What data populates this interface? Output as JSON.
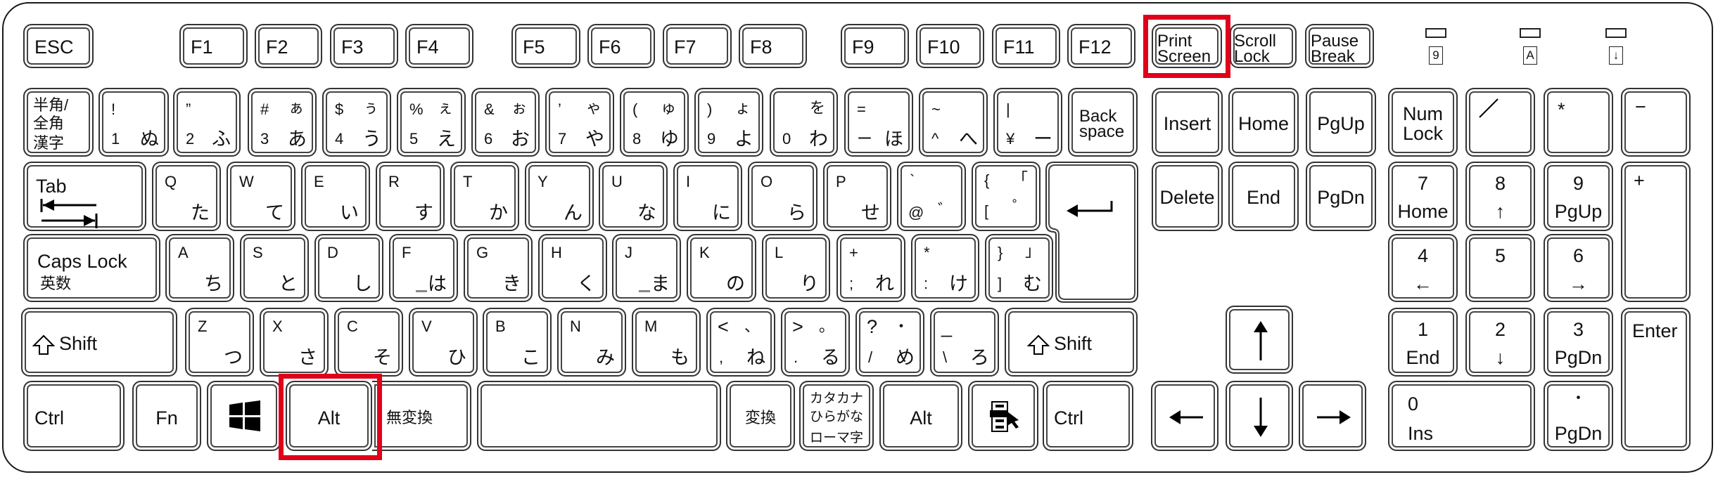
{
  "keyboard": {
    "layout": "JIS",
    "highlight_color": "#e0001b",
    "highlighted_keys": [
      "Print Screen",
      "Alt"
    ],
    "function_row": {
      "esc": "ESC",
      "f_keys": [
        "F1",
        "F2",
        "F3",
        "F4",
        "F5",
        "F6",
        "F7",
        "F8",
        "F9",
        "F10",
        "F11",
        "F12"
      ],
      "print_screen": [
        "Print",
        "Screen"
      ],
      "scroll_lock": [
        "Scroll",
        "Lock"
      ],
      "pause_break": [
        "Pause",
        "Break"
      ]
    },
    "indicators": [
      {
        "name": "num-lock-indicator",
        "glyph": "9"
      },
      {
        "name": "caps-lock-indicator",
        "glyph": "A"
      },
      {
        "name": "scroll-lock-indicator",
        "glyph": "↓"
      }
    ],
    "number_row": {
      "hankaku": [
        "半角/",
        "全角",
        "漢字"
      ],
      "keys": [
        {
          "shift": "!",
          "base": "1",
          "kana_shift": "",
          "kana": "ぬ"
        },
        {
          "shift": "”",
          "base": "2",
          "kana_shift": "",
          "kana": "ふ"
        },
        {
          "shift": "#",
          "base": "3",
          "kana_shift": "ぁ",
          "kana": "あ"
        },
        {
          "shift": "$",
          "base": "4",
          "kana_shift": "ぅ",
          "kana": "う"
        },
        {
          "shift": "%",
          "base": "5",
          "kana_shift": "ぇ",
          "kana": "え"
        },
        {
          "shift": "&",
          "base": "6",
          "kana_shift": "ぉ",
          "kana": "お"
        },
        {
          "shift": "’",
          "base": "7",
          "kana_shift": "ゃ",
          "kana": "や"
        },
        {
          "shift": "(",
          "base": "8",
          "kana_shift": "ゅ",
          "kana": "ゆ"
        },
        {
          "shift": ")",
          "base": "9",
          "kana_shift": "ょ",
          "kana": "よ"
        },
        {
          "shift": "",
          "base": "0",
          "kana_shift": "を",
          "kana": "わ"
        },
        {
          "shift": "=",
          "base": "ー",
          "kana_shift": "",
          "kana": "ほ"
        },
        {
          "shift": "~",
          "base": "^",
          "kana_shift": "",
          "kana": "へ"
        },
        {
          "shift": "|",
          "base": "¥",
          "kana_shift": "",
          "kana": "ー"
        }
      ],
      "backspace": [
        "Back",
        "space"
      ]
    },
    "tab_row": {
      "tab": "Tab",
      "keys": [
        {
          "base": "Q",
          "kana": "た"
        },
        {
          "base": "W",
          "kana": "て"
        },
        {
          "base": "E",
          "kana": "い"
        },
        {
          "base": "R",
          "kana": "す"
        },
        {
          "base": "T",
          "kana": "か"
        },
        {
          "base": "Y",
          "kana": "ん"
        },
        {
          "base": "U",
          "kana": "な"
        },
        {
          "base": "I",
          "kana": "に"
        },
        {
          "base": "O",
          "kana": "ら"
        },
        {
          "base": "P",
          "kana": "せ"
        }
      ],
      "at_key": {
        "shift": "`",
        "base": "@",
        "kana": "゛"
      },
      "bracket_key": {
        "shift": "{",
        "base": "[",
        "kana_shift": "「",
        "kana": "゜"
      },
      "enter": "Enter"
    },
    "home_row": {
      "caps_lock": "Caps Lock",
      "caps_sub": "英数",
      "keys": [
        {
          "base": "A",
          "kana": "ち"
        },
        {
          "base": "S",
          "kana": "と"
        },
        {
          "base": "D",
          "kana": "し"
        },
        {
          "base": "F",
          "kana": "は"
        },
        {
          "base": "G",
          "kana": "き"
        },
        {
          "base": "H",
          "kana": "く"
        },
        {
          "base": "J",
          "kana": "ま"
        },
        {
          "base": "K",
          "kana": "の"
        },
        {
          "base": "L",
          "kana": "り"
        }
      ],
      "semicolon_key": {
        "shift": "+",
        "base": ";",
        "kana": "れ"
      },
      "colon_key": {
        "shift": "*",
        "base": ":",
        "kana": "け"
      },
      "close_bracket_key": {
        "shift": "}",
        "base": "]",
        "kana_shift": "」",
        "kana": "む"
      }
    },
    "shift_row": {
      "left_shift": "Shift",
      "keys": [
        {
          "base": "Z",
          "kana": "つ"
        },
        {
          "base": "X",
          "kana": "さ"
        },
        {
          "base": "C",
          "kana": "そ"
        },
        {
          "base": "V",
          "kana": "ひ"
        },
        {
          "base": "B",
          "kana": "こ"
        },
        {
          "base": "N",
          "kana": "み"
        },
        {
          "base": "M",
          "kana": "も"
        }
      ],
      "comma_key": {
        "shift": "<",
        "base": ",",
        "kana_shift": "、",
        "kana": "ね"
      },
      "period_key": {
        "shift": ">",
        "base": ".",
        "kana_shift": "。",
        "kana": "る"
      },
      "slash_key": {
        "shift": "?",
        "base": "/",
        "kana_shift": "・",
        "kana": "め"
      },
      "backslash_key": {
        "shift": "_",
        "base": "\\",
        "kana": "ろ"
      },
      "right_shift": "Shift"
    },
    "bottom_row": {
      "left_ctrl": "Ctrl",
      "fn": "Fn",
      "left_alt": "Alt",
      "muhenkan": "無変換",
      "henkan": "変換",
      "kana_key": [
        "カタカナ",
        "ひらがな",
        "ローマ字"
      ],
      "right_alt": "Alt",
      "right_ctrl": "Ctrl"
    },
    "nav_cluster": {
      "insert": "Insert",
      "home": "Home",
      "page_up": "PgUp",
      "delete": "Delete",
      "end": "End",
      "page_down": "PgDn"
    },
    "numpad": {
      "num_lock": [
        "Num",
        "Lock"
      ],
      "divide": "/",
      "multiply": "*",
      "minus": "−",
      "plus": "+",
      "n7": [
        "7",
        "Home"
      ],
      "n8": [
        "8",
        "↑"
      ],
      "n9": [
        "9",
        "PgUp"
      ],
      "n4": [
        "4",
        "←"
      ],
      "n5": [
        "5"
      ],
      "n6": [
        "6",
        "→"
      ],
      "n1": [
        "1",
        "End"
      ],
      "n2": [
        "2",
        "↓"
      ],
      "n3": [
        "3",
        "PgDn"
      ],
      "n0": [
        "0",
        "Ins"
      ],
      "decimal": [
        "・",
        "PgDn"
      ],
      "enter": "Enter"
    }
  }
}
